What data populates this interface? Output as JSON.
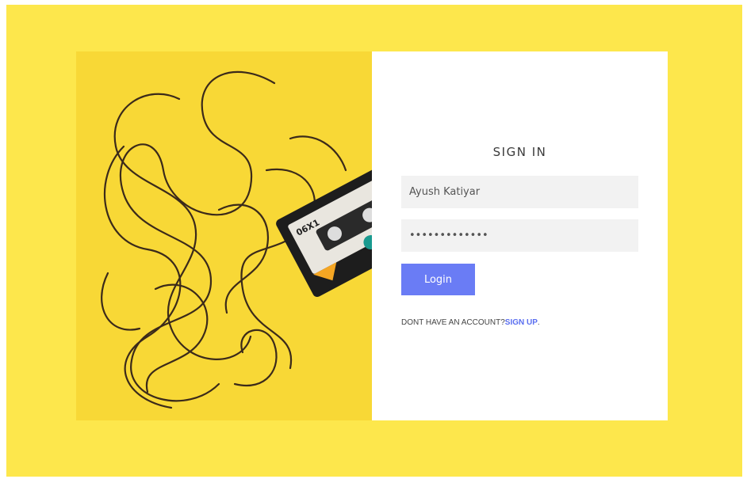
{
  "page": {
    "background_color": "#fde74c",
    "accent_color": "#6a7cf5"
  },
  "hero_image": {
    "description_icon": "cassette-tape-image",
    "cassette_label": "06X1"
  },
  "login_form": {
    "title": "SIGN IN",
    "username_value": "Ayush Katiyar",
    "password_value": "•••••••••••••",
    "login_button_label": "Login",
    "signup_prompt": "DONT HAVE AN ACCOUNT?",
    "signup_link_label": "SIGN UP",
    "signup_suffix": "."
  }
}
